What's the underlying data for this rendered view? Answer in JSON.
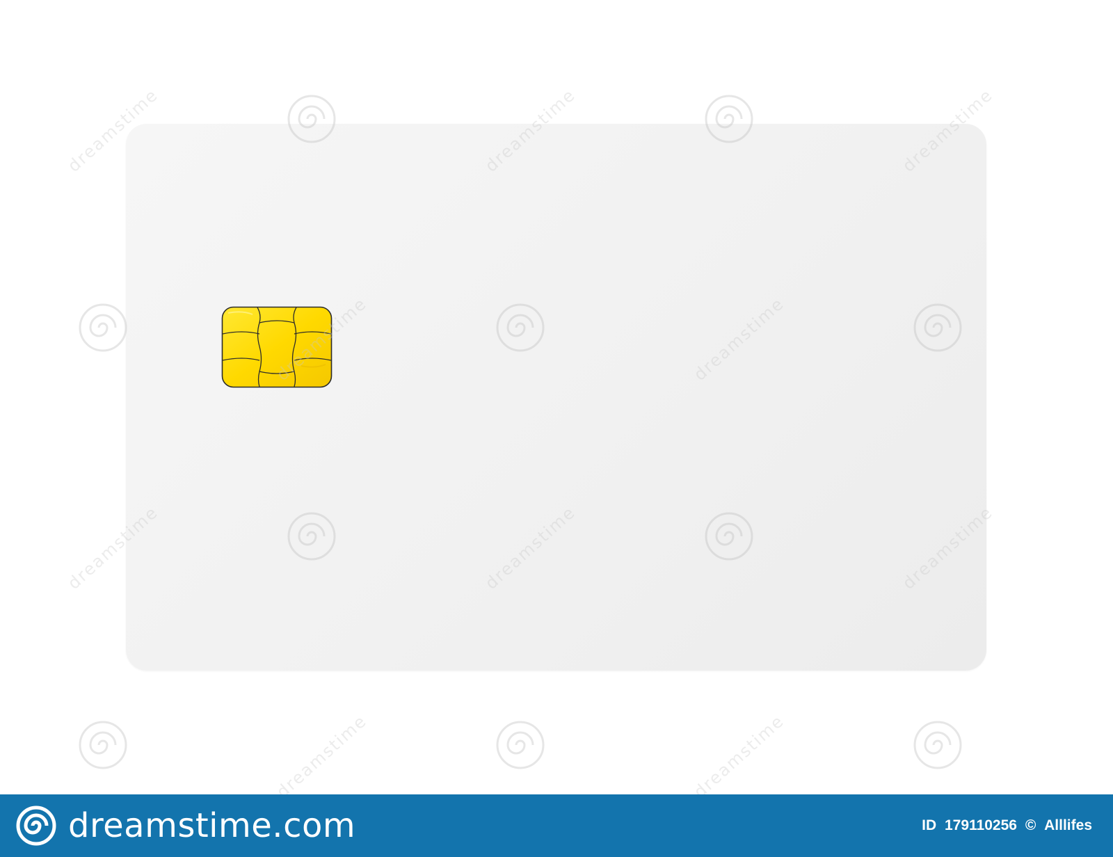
{
  "image": {
    "subject": "blank-smart-card",
    "card_color": "#f2f2f2",
    "chip_color": "#ffe000",
    "chip_line_color": "#2b2b2b"
  },
  "watermark": {
    "repeat_text": "dreamstime",
    "color": "#d6d6d6"
  },
  "footer": {
    "background_color": "#1374ad",
    "logo_text": "dreamstime.com",
    "id_label": "ID",
    "id_number": "179110256",
    "copyright_symbol": "©",
    "author": "Alllifes",
    "icons": {
      "logo": "dreamstime-swirl-icon"
    }
  }
}
